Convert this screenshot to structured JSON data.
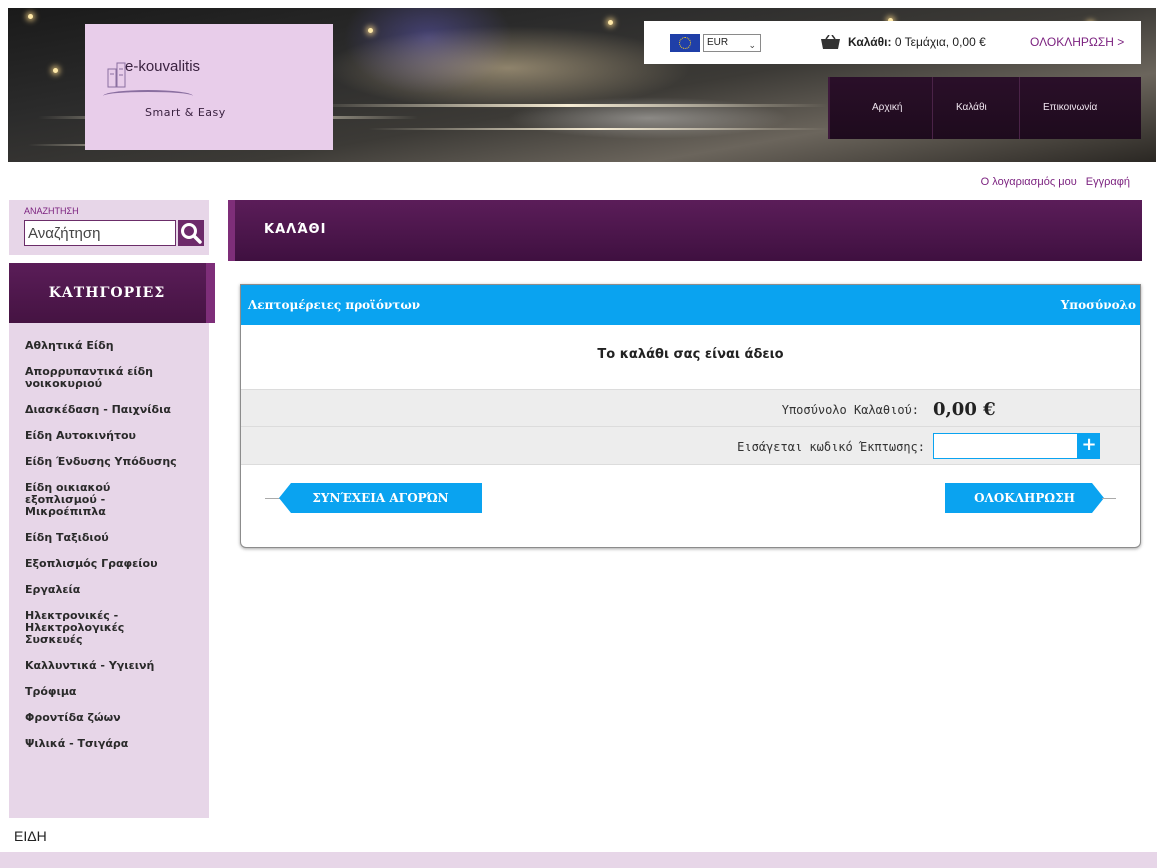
{
  "header": {
    "logo": {
      "name": "e-kouvalitis",
      "tagline": "Smart & Easy"
    },
    "currency": {
      "selected": "EUR"
    },
    "cart": {
      "label": "Καλάθι:",
      "summary": "0 Τεμάχια, 0,00 €",
      "checkout_link": "ΟΛΟΚΛΗΡΩΣΗ >"
    },
    "nav": [
      {
        "label": "Αρχική"
      },
      {
        "label": "Καλάθι"
      },
      {
        "label": "Επικοινωνία"
      }
    ],
    "account_links": {
      "my_account": "Ο λογαριασμός μου",
      "register": "Εγγραφή"
    }
  },
  "sidebar": {
    "search": {
      "label": "ΑΝΑΖΗΤΗΣΗ",
      "placeholder": "Αναζήτηση"
    },
    "categories_title": "ΚΑΤΗΓΟΡΙΕΣ",
    "categories": [
      "Αθλητικά Είδη",
      "Απορρυπαντικά είδη νοικοκυριού",
      "Διασκέδαση - Παιχνίδια",
      "Είδη Αυτοκινήτου",
      "Είδη Ένδυσης Υπόδυσης",
      "Είδη οικιακού εξοπλισμού - Μικροέπιπλα",
      "Είδη Ταξιδιού",
      "Εξοπλισμός Γραφείου",
      "Εργαλεία",
      "Ηλεκτρονικές - Ηλεκτρολογικές Συσκευές",
      "Καλλυντικά - Υγιεινή",
      "Τρόφιμα",
      "Φροντίδα ζώων",
      "Ψιλικά - Τσιγάρα"
    ]
  },
  "main": {
    "page_title": "ΚΑΛΆΘΙ",
    "table": {
      "col_details": "Λεπτομέρειες προϊόντων",
      "col_subtotal": "Υποσύνολο"
    },
    "empty_message": "Το καλάθι σας είναι άδειο",
    "subtotal": {
      "label": "Υποσύνολο Καλαθιού:",
      "value": "0,00 €"
    },
    "coupon": {
      "label": "Εισάγεται κωδικό Έκπτωσης:",
      "button": "+"
    },
    "buttons": {
      "continue": "ΣΥΝΈΧΕΙΑ ΑΓΟΡΏΝ",
      "checkout": "ΟΛΟΚΛΗΡΩΣΗ"
    }
  },
  "bottom": {
    "section_label": "ΕΙΔΗ"
  },
  "colors": {
    "accent_purple": "#5a1d58",
    "accent_blue": "#0aa3f0",
    "sidebar_bg": "#e7d6e8",
    "logo_bg": "#e8cdea"
  }
}
